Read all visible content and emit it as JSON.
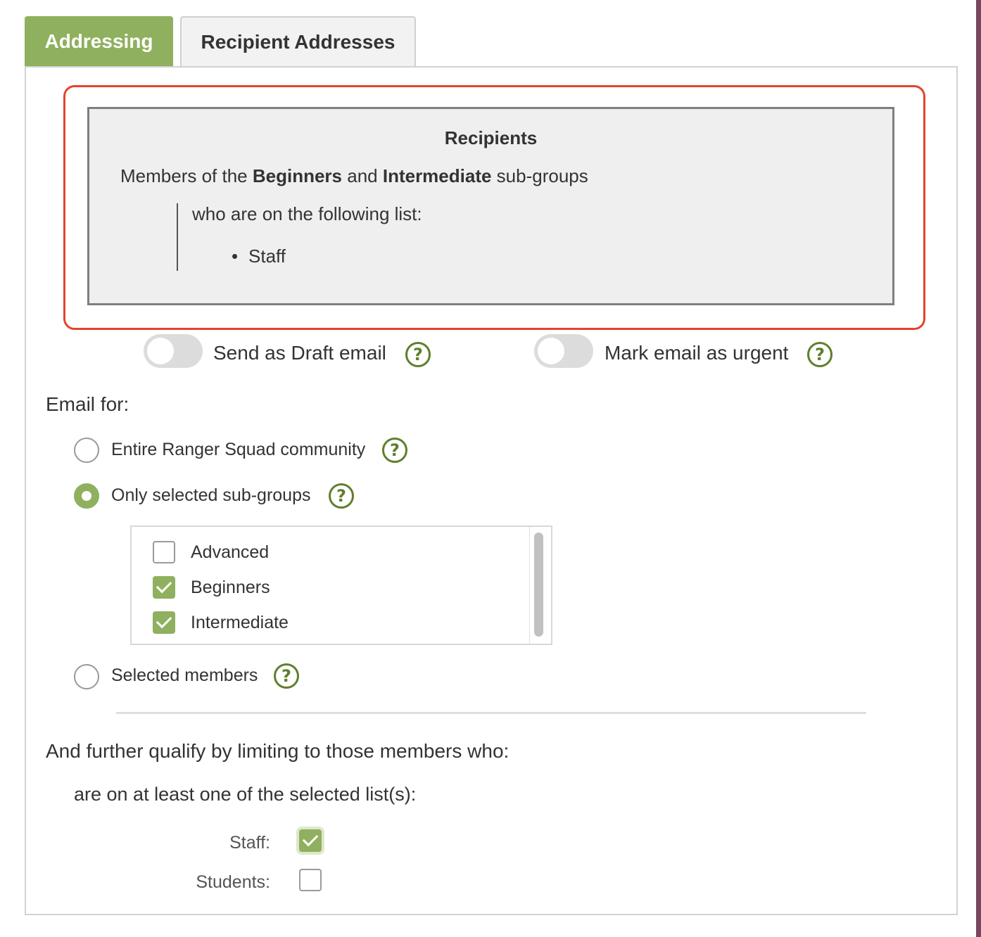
{
  "tabs": [
    {
      "label": "Addressing",
      "active": true
    },
    {
      "label": "Recipient Addresses",
      "active": false
    }
  ],
  "summary": {
    "title": "Recipients",
    "line_prefix": "Members of the ",
    "group1": "Beginners",
    "line_and": " and ",
    "group2": "Intermediate",
    "line_suffix": " sub-groups",
    "list_intro": "who are on the following list:",
    "lists": [
      "Staff"
    ]
  },
  "options": {
    "draft_label": "Send as Draft email",
    "draft_on": false,
    "urgent_label": "Mark email as urgent",
    "urgent_on": false
  },
  "email_for": {
    "label": "Email for:",
    "choices": [
      {
        "label": "Entire Ranger Squad community",
        "selected": false
      },
      {
        "label": "Only selected sub-groups",
        "selected": true
      },
      {
        "label": "Selected members",
        "selected": false
      }
    ],
    "subgroups": [
      {
        "label": "Advanced",
        "checked": false
      },
      {
        "label": "Beginners",
        "checked": true
      },
      {
        "label": "Intermediate",
        "checked": true
      }
    ]
  },
  "qualify": {
    "heading": "And further qualify by limiting to those members who:",
    "sub_heading": "are on at least one of the selected list(s):",
    "lists": [
      {
        "label": "Staff:",
        "checked": true
      },
      {
        "label": "Students:",
        "checked": false
      }
    ]
  },
  "icons": {
    "help": "?"
  },
  "colors": {
    "accent": "#8fb05e",
    "help": "#5e7f2c",
    "highlight": "#e5432e",
    "side_strip": "#7a4560"
  }
}
